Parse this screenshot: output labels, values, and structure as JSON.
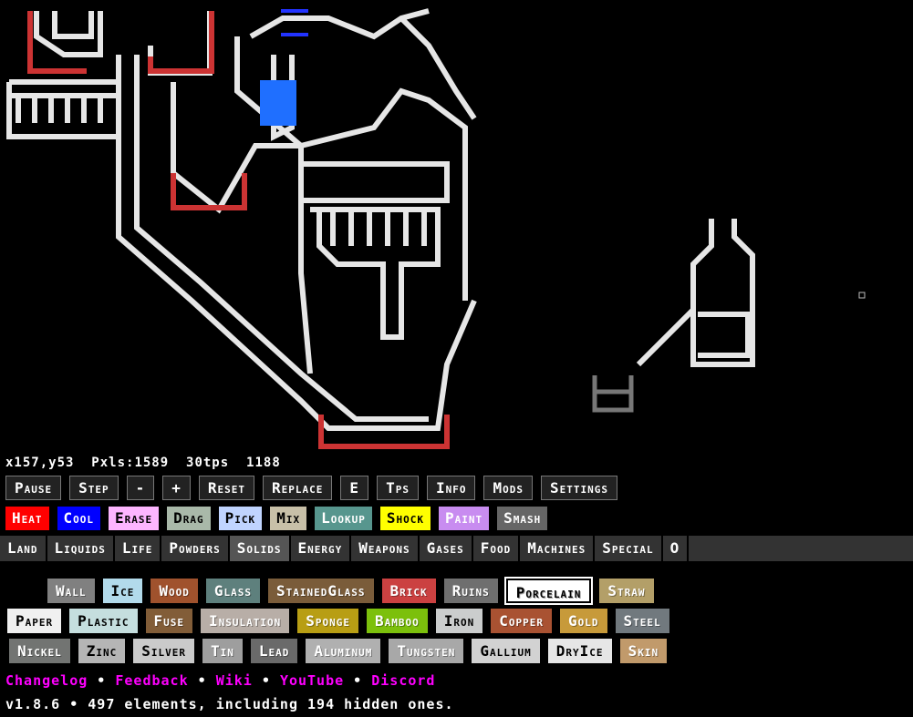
{
  "stats": {
    "coords": "x157,y53",
    "pixels": "Pxls:1589",
    "tps": "30tps",
    "ticks": "1188"
  },
  "controls": [
    {
      "id": "pause",
      "label": "Pause"
    },
    {
      "id": "step",
      "label": "Step"
    },
    {
      "id": "minus",
      "label": "-"
    },
    {
      "id": "plus",
      "label": "+"
    },
    {
      "id": "reset",
      "label": "Reset"
    },
    {
      "id": "replace",
      "label": "Replace"
    },
    {
      "id": "e",
      "label": "E"
    },
    {
      "id": "tps",
      "label": "Tps"
    },
    {
      "id": "info",
      "label": "Info"
    },
    {
      "id": "mods",
      "label": "Mods"
    },
    {
      "id": "settings",
      "label": "Settings"
    }
  ],
  "tools": [
    {
      "id": "heat",
      "label": "Heat",
      "color": "#ff0000",
      "text": "light"
    },
    {
      "id": "cool",
      "label": "Cool",
      "color": "#0000ff",
      "text": "light"
    },
    {
      "id": "erase",
      "label": "Erase",
      "color": "#fdb5ff",
      "text": "dark"
    },
    {
      "id": "drag",
      "label": "Drag",
      "color": "#a9b9a9",
      "text": "dark"
    },
    {
      "id": "pick",
      "label": "Pick",
      "color": "#c0d4ff",
      "text": "dark"
    },
    {
      "id": "mix",
      "label": "Mix",
      "color": "#c8c0a8",
      "text": "dark"
    },
    {
      "id": "lookup",
      "label": "Lookup",
      "color": "#57968e",
      "text": "light"
    },
    {
      "id": "shock",
      "label": "Shock",
      "color": "#ffff00",
      "text": "dark"
    },
    {
      "id": "paint",
      "label": "Paint",
      "color": "#c88cf0",
      "text": "light"
    },
    {
      "id": "smash",
      "label": "Smash",
      "color": "#666666",
      "text": "light"
    }
  ],
  "categories": [
    "Land",
    "Liquids",
    "Life",
    "Powders",
    "Solids",
    "Energy",
    "Weapons",
    "Gases",
    "Food",
    "Machines",
    "Special",
    "O"
  ],
  "active_category": "Solids",
  "elements": [
    [
      {
        "label": "Wall",
        "color": "#808080"
      },
      {
        "label": "Ice",
        "color": "#b2daeb",
        "text": "dark"
      },
      {
        "label": "Wood",
        "color": "#a0522d"
      },
      {
        "label": "Glass",
        "color": "#5e807d"
      },
      {
        "label": "StainedGlass",
        "color": "#7a5c3a"
      },
      {
        "label": "Brick",
        "color": "#cb4141"
      },
      {
        "label": "Ruins",
        "color": "#6f6f6f"
      },
      {
        "label": "Porcelain",
        "color": "#ffffff",
        "selected": true
      },
      {
        "label": "Straw",
        "color": "#b39f68"
      }
    ],
    [
      {
        "label": "Paper",
        "color": "#f0f0f0",
        "text": "dark"
      },
      {
        "label": "Plastic",
        "color": "#c5dede",
        "text": "dark"
      },
      {
        "label": "Fuse",
        "color": "#825d38"
      },
      {
        "label": "Insulation",
        "color": "#b8aea7"
      },
      {
        "label": "Sponge",
        "color": "#b89e14"
      },
      {
        "label": "Bamboo",
        "color": "#7cc00c"
      },
      {
        "label": "Iron",
        "color": "#cbcdcd",
        "text": "dark"
      },
      {
        "label": "Copper",
        "color": "#a95232"
      },
      {
        "label": "Gold",
        "color": "#c79a3a"
      },
      {
        "label": "Steel",
        "color": "#71797e"
      }
    ],
    [
      {
        "label": "Nickel",
        "color": "#727472"
      },
      {
        "label": "Zinc",
        "color": "#b5b5b5",
        "text": "dark"
      },
      {
        "label": "Silver",
        "color": "#cacaca",
        "text": "dark"
      },
      {
        "label": "Tin",
        "color": "#9e9e9e"
      },
      {
        "label": "Lead",
        "color": "#6a6a6a"
      },
      {
        "label": "Aluminum",
        "color": "#b0b0b0"
      },
      {
        "label": "Tungsten",
        "color": "#a8a8a8"
      },
      {
        "label": "Gallium",
        "color": "#d2d2d2",
        "text": "dark"
      },
      {
        "label": "DryIce",
        "color": "#e6e6e6",
        "text": "dark"
      },
      {
        "label": "Skin",
        "color": "#c19a6b"
      }
    ]
  ],
  "links": [
    "Changelog",
    "Feedback",
    "Wiki",
    "YouTube",
    "Discord"
  ],
  "version": "v1.8.6 • 497 elements, including 194 hidden ones."
}
